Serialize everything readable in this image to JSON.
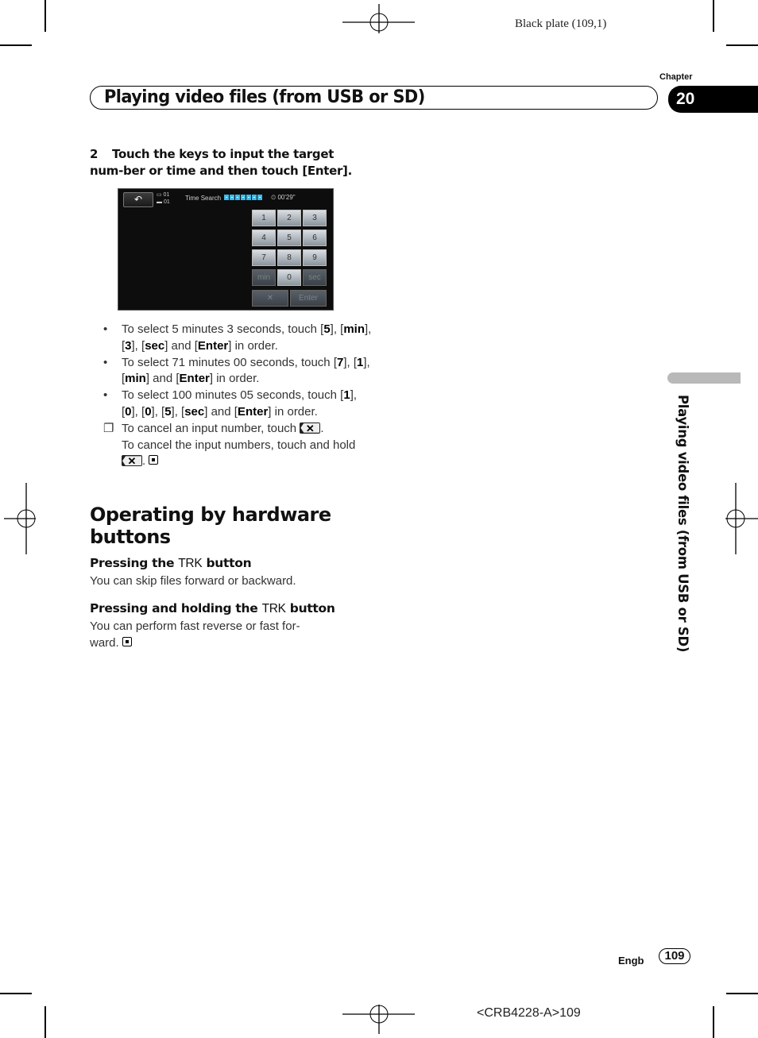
{
  "print_marks": {
    "plate_label": "Black plate (109,1)",
    "job_code": "<CRB4228-A>109"
  },
  "header": {
    "chapter_label": "Chapter",
    "chapter_number": "20",
    "title": "Playing video files (from USB or SD)"
  },
  "step": {
    "number": "2",
    "text": "Touch the keys to input the target num-ber or time and then touch [Enter]."
  },
  "screen": {
    "back_icon": "↶",
    "source_line1": "▭ 01",
    "source_line2": "▬ 01",
    "time_search_label": "Time Search",
    "input_slots": 7,
    "elapsed_time": "⏲ 00'29\"",
    "keys": [
      {
        "label": "1",
        "enabled": true
      },
      {
        "label": "2",
        "enabled": true
      },
      {
        "label": "3",
        "enabled": true
      },
      {
        "label": "4",
        "enabled": true
      },
      {
        "label": "5",
        "enabled": true
      },
      {
        "label": "6",
        "enabled": true
      },
      {
        "label": "7",
        "enabled": true
      },
      {
        "label": "8",
        "enabled": true
      },
      {
        "label": "9",
        "enabled": true
      },
      {
        "label": "min",
        "enabled": false
      },
      {
        "label": "0",
        "enabled": true
      },
      {
        "label": "sec",
        "enabled": false
      }
    ],
    "delete_key": {
      "label": "✕",
      "enabled": false
    },
    "enter_key": {
      "label": "Enter",
      "enabled": false
    }
  },
  "bullets": [
    {
      "marker": "•",
      "parts": [
        [
          "To select 5 minutes 3 seconds, touch [",
          0
        ],
        [
          "5",
          1
        ],
        [
          "], [",
          0
        ],
        [
          "min",
          1
        ],
        [
          "], [",
          0
        ],
        [
          "3",
          1
        ],
        [
          "], [",
          0
        ],
        [
          "sec",
          1
        ],
        [
          "] and [",
          0
        ],
        [
          "Enter",
          1
        ],
        [
          "] in order.",
          0
        ]
      ]
    },
    {
      "marker": "•",
      "parts": [
        [
          "To select 71 minutes 00 seconds, touch [",
          0
        ],
        [
          "7",
          1
        ],
        [
          "], [",
          0
        ],
        [
          "1",
          1
        ],
        [
          "], [",
          0
        ],
        [
          "min",
          1
        ],
        [
          "] and [",
          0
        ],
        [
          "Enter",
          1
        ],
        [
          "] in order.",
          0
        ]
      ]
    },
    {
      "marker": "•",
      "parts": [
        [
          "To select 100 minutes 05 seconds, touch [",
          0
        ],
        [
          "1",
          1
        ],
        [
          "], [",
          0
        ],
        [
          "0",
          1
        ],
        [
          "], [",
          0
        ],
        [
          "0",
          1
        ],
        [
          "], [",
          0
        ],
        [
          "5",
          1
        ],
        [
          "], [",
          0
        ],
        [
          "sec",
          1
        ],
        [
          "] and [",
          0
        ],
        [
          "Enter",
          1
        ],
        [
          "] in order.",
          0
        ]
      ]
    }
  ],
  "note": {
    "marker": "❐",
    "line1": "To cancel an input number, touch",
    "line2": "To cancel the input numbers, touch and hold",
    "delete_icon": "✕"
  },
  "section": {
    "title": "Operating by hardware buttons",
    "sub1_prefix": "Pressing the ",
    "sub1_trk": "TRK",
    "sub1_suffix": " button",
    "sub1_text": "You can skip files forward or backward.",
    "sub2_prefix": "Pressing and holding the ",
    "sub2_trk": "TRK",
    "sub2_suffix": " button",
    "sub2_text": "You can perform fast reverse or fast for-ward."
  },
  "side_tab": {
    "text": "Playing video files (from USB or SD)"
  },
  "footer": {
    "language": "Engb",
    "page_number": "109"
  }
}
